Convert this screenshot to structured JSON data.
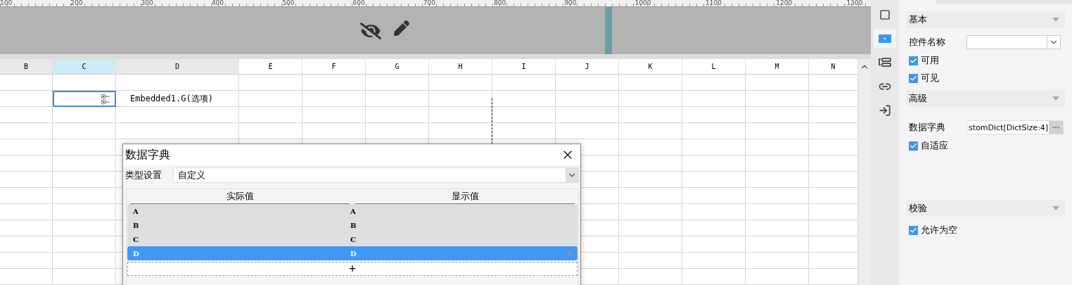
{
  "ruler": {
    "labels": [
      "100",
      "200",
      "300",
      "400",
      "500",
      "600",
      "700",
      "800",
      "900",
      "1000",
      "1100",
      "1200",
      "1300"
    ]
  },
  "sheet": {
    "columns": [
      {
        "label": "B",
        "selected": false
      },
      {
        "label": "C",
        "selected": true
      },
      {
        "label": "D",
        "selected": false
      },
      {
        "label": "E",
        "selected": false
      },
      {
        "label": "F",
        "selected": false
      },
      {
        "label": "G",
        "selected": false
      },
      {
        "label": "H",
        "selected": false
      },
      {
        "label": "I",
        "selected": false
      },
      {
        "label": "J",
        "selected": false
      },
      {
        "label": "K",
        "selected": false
      },
      {
        "label": "L",
        "selected": false
      },
      {
        "label": "M",
        "selected": false
      },
      {
        "label": "N",
        "selected": false
      }
    ],
    "cell_text": "Embedded1.G(选项)"
  },
  "dialog": {
    "title": "数据字典",
    "type_label": "类型设置",
    "type_value": "自定义",
    "table": {
      "columns": [
        "实际值",
        "显示值"
      ],
      "rows": [
        {
          "actual": "A",
          "display": "A",
          "selected": false
        },
        {
          "actual": "B",
          "display": "B",
          "selected": false
        },
        {
          "actual": "C",
          "display": "C",
          "selected": false
        },
        {
          "actual": "D",
          "display": "D",
          "selected": true
        }
      ],
      "add_label": "+"
    }
  },
  "side_icons": [
    {
      "kind": "frame",
      "selected": false
    },
    {
      "kind": "combo",
      "selected": true
    },
    {
      "kind": "form",
      "selected": false
    },
    {
      "kind": "link",
      "selected": false
    },
    {
      "kind": "import",
      "selected": false
    }
  ],
  "sections": [
    {
      "title": "基本",
      "items": [
        {
          "kind": "select",
          "label": "控件名称"
        },
        {
          "kind": "checkbox",
          "label": "可用",
          "checked": true
        },
        {
          "kind": "checkbox",
          "label": "可见",
          "checked": true
        }
      ]
    },
    {
      "title": "高级",
      "items": [
        {
          "kind": "text",
          "label": "数据字典",
          "value": "stomDict[DictSize:4]"
        },
        {
          "kind": "checkbox",
          "label": "自适应",
          "checked": true
        }
      ]
    },
    {
      "title": "校验",
      "items": [
        {
          "kind": "checkbox",
          "label": "允许为空",
          "checked": true
        }
      ]
    }
  ]
}
